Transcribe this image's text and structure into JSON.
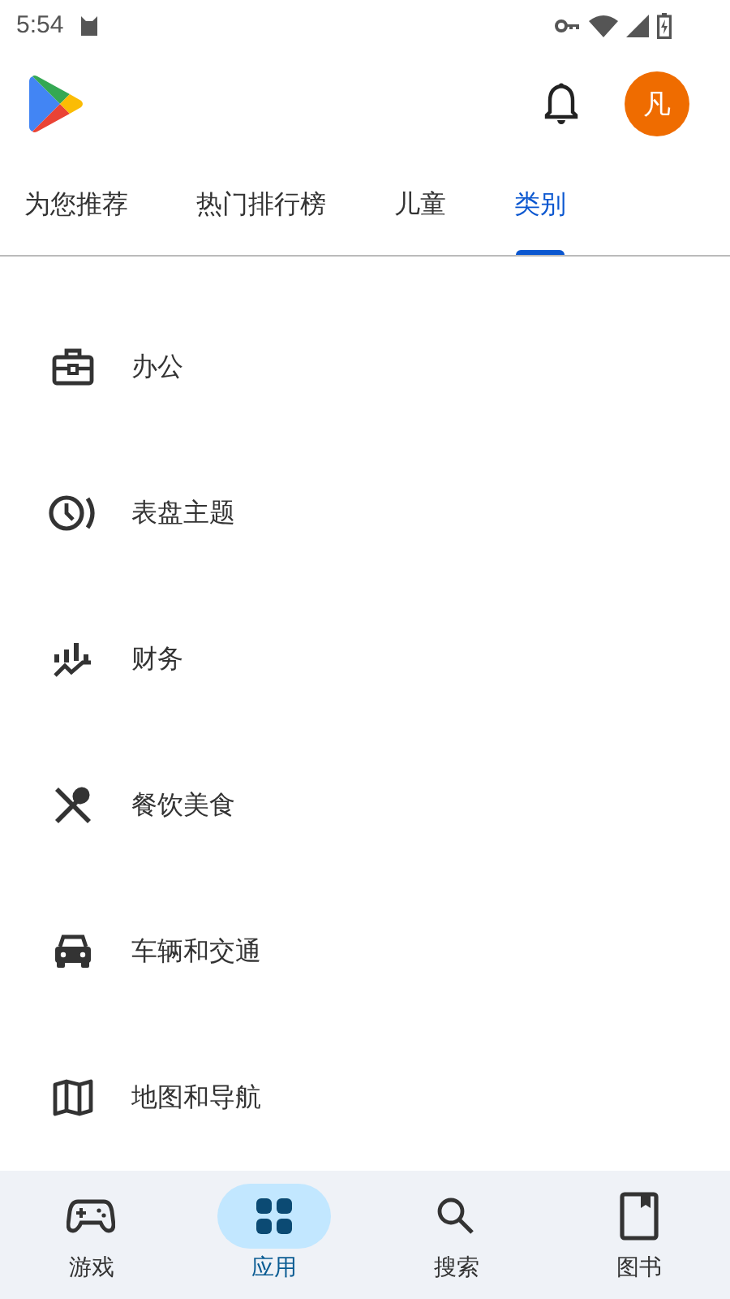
{
  "status_bar": {
    "time": "5:54"
  },
  "header": {
    "avatar_letter": "凡"
  },
  "tabs": [
    {
      "label": "为您推荐",
      "selected": false
    },
    {
      "label": "热门排行榜",
      "selected": false
    },
    {
      "label": "儿童",
      "selected": false
    },
    {
      "label": "类别",
      "selected": true
    }
  ],
  "categories": [
    {
      "label": "办公",
      "kind": "briefcase"
    },
    {
      "label": "表盘主题",
      "kind": "watch"
    },
    {
      "label": "财务",
      "kind": "finance"
    },
    {
      "label": "餐饮美食",
      "kind": "food"
    },
    {
      "label": "车辆和交通",
      "kind": "car"
    },
    {
      "label": "地图和导航",
      "kind": "map"
    }
  ],
  "bottom_nav": [
    {
      "label": "游戏",
      "kind": "games",
      "selected": false
    },
    {
      "label": "应用",
      "kind": "apps",
      "selected": true
    },
    {
      "label": "搜索",
      "kind": "search",
      "selected": false
    },
    {
      "label": "图书",
      "kind": "books",
      "selected": false
    }
  ]
}
